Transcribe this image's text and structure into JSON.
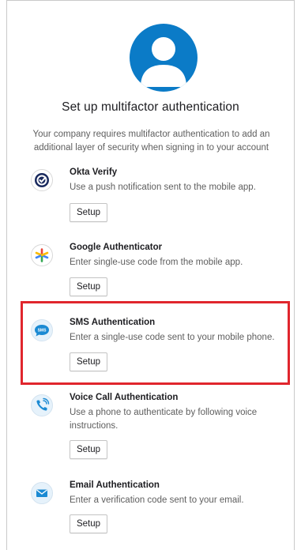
{
  "title": "Set up multifactor authentication",
  "description": "Your company requires multifactor authentication to add an additional layer of security when signing in to your account",
  "colors": {
    "accent": "#0b7bc7",
    "highlight": "#e0262d",
    "google_star": [
      "#4285f4",
      "#ea4335",
      "#fbbc05",
      "#34a853"
    ]
  },
  "factors": [
    {
      "name": "Okta Verify",
      "description": "Use a push notification sent to the mobile app.",
      "setup_label": "Setup",
      "icon": "okta-verify-icon"
    },
    {
      "name": "Google Authenticator",
      "description": "Enter single-use code from the mobile app.",
      "setup_label": "Setup",
      "icon": "google-authenticator-icon"
    },
    {
      "name": "SMS Authentication",
      "description": "Enter a single-use code sent to your mobile phone.",
      "setup_label": "Setup",
      "icon": "sms-icon",
      "icon_text": "SMS",
      "highlighted": true
    },
    {
      "name": "Voice Call Authentication",
      "description": "Use a phone to authenticate by following voice instructions.",
      "setup_label": "Setup",
      "icon": "phone-call-icon"
    },
    {
      "name": "Email Authentication",
      "description": "Enter a verification code sent to your email.",
      "setup_label": "Setup",
      "icon": "email-icon"
    }
  ]
}
